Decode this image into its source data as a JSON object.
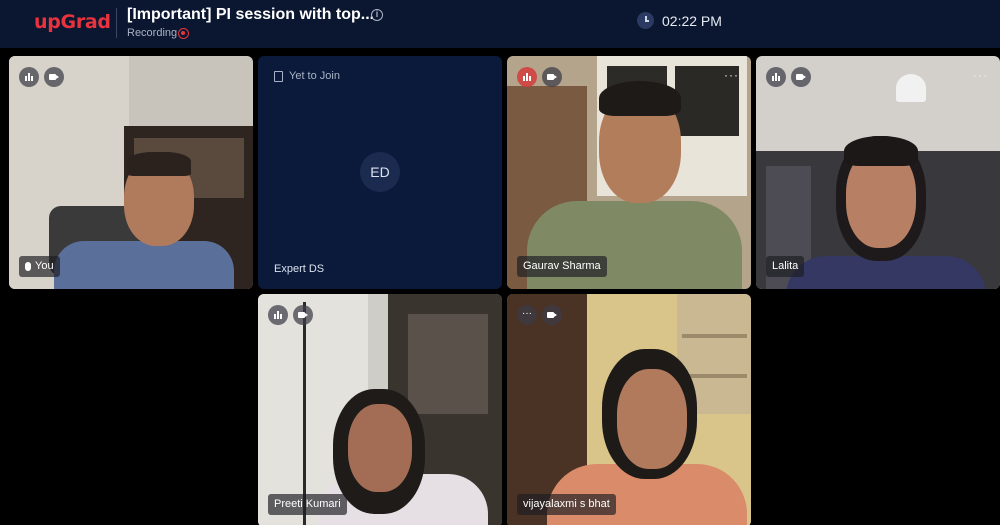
{
  "header": {
    "logo": "upGrad",
    "title": "[Important] PI session with top...",
    "recording_label": "Recording",
    "time": "02:22 PM"
  },
  "tiles": [
    {
      "name": "You",
      "state": "video"
    },
    {
      "name": "Expert DS",
      "state": "Yet to Join",
      "initials": "ED"
    },
    {
      "name": "Gaurav Sharma",
      "state": "video"
    },
    {
      "name": "Lalita",
      "state": "video"
    },
    {
      "name": "Preeti Kumari",
      "state": "video"
    },
    {
      "name": "vijayalaxmi s bhat",
      "state": "video"
    }
  ],
  "icons": {
    "audio_level": "audio-level-icon",
    "camera": "camera-icon",
    "more": "more-options-icon",
    "recording": "recording-icon",
    "clock": "clock-icon",
    "info": "info-icon"
  },
  "colors": {
    "brand": "#e8323d",
    "header_bg": "#0b1730",
    "tile_bg": "#0b1a3b"
  }
}
